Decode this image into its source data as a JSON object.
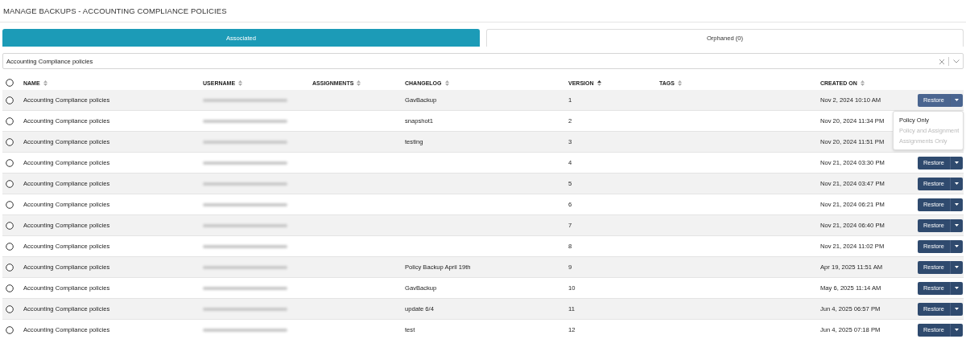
{
  "title": "MANAGE BACKUPS - ACCOUNTING COMPLIANCE POLICIES",
  "tabs": [
    {
      "label": "Associated",
      "selected": true
    },
    {
      "label": "Orphaned (0)",
      "selected": false
    }
  ],
  "filter": {
    "value": "Accounting Compliance policies"
  },
  "table": {
    "select_all": {
      "checked": false
    },
    "columns": [
      {
        "label": "NAME",
        "sorted": false
      },
      {
        "label": "USERNAME",
        "sorted": false
      },
      {
        "label": "ASSIGNMENTS",
        "sorted": false
      },
      {
        "label": "CHANGELOG",
        "sorted": false
      },
      {
        "label": "VERSION",
        "sorted": true
      },
      {
        "label": "TAGS",
        "sorted": false
      },
      {
        "label": "CREATED ON",
        "sorted": false
      }
    ],
    "rows": [
      {
        "checked": false,
        "name": "Accounting Compliance policies",
        "changelog": "GavBackup",
        "version": "1",
        "created": "Nov 2, 2024 10:10 AM",
        "action": "Restore"
      },
      {
        "checked": false,
        "name": "Accounting Compliance policies",
        "changelog": "snapshot1",
        "version": "2",
        "created": "Nov 20, 2024 11:34 PM"
      },
      {
        "checked": false,
        "name": "Accounting Compliance policies",
        "changelog": "testing",
        "version": "3",
        "created": "Nov 20, 2024 11:51 PM"
      },
      {
        "checked": false,
        "name": "Accounting Compliance policies",
        "version": "4",
        "created": "Nov 21, 2024 03:30 PM",
        "action": "Restore"
      },
      {
        "checked": false,
        "name": "Accounting Compliance policies",
        "version": "5",
        "created": "Nov 21, 2024 03:47 PM",
        "action": "Restore"
      },
      {
        "checked": false,
        "name": "Accounting Compliance policies",
        "version": "6",
        "created": "Nov 21, 2024 06:21 PM",
        "action": "Restore"
      },
      {
        "checked": false,
        "name": "Accounting Compliance policies",
        "version": "7",
        "created": "Nov 21, 2024 06:40 PM",
        "action": "Restore"
      },
      {
        "checked": false,
        "name": "Accounting Compliance policies",
        "version": "8",
        "created": "Nov 21, 2024 11:02 PM",
        "action": "Restore"
      },
      {
        "checked": false,
        "name": "Accounting Compliance policies",
        "changelog": "Policy Backup April 19th",
        "version": "9",
        "created": "Apr 19, 2025 11:51 AM",
        "action": "Restore"
      },
      {
        "checked": false,
        "name": "Accounting Compliance policies",
        "changelog": "GavBackup",
        "version": "10",
        "created": "May 6, 2025 11:14 AM",
        "action": "Restore"
      },
      {
        "checked": false,
        "name": "Accounting Compliance policies",
        "changelog": "update 6/4",
        "version": "11",
        "created": "Jun 4, 2025 06:57 PM",
        "action": "Restore"
      },
      {
        "checked": false,
        "name": "Accounting Compliance policies",
        "changelog": "test",
        "version": "12",
        "created": "Jun 4, 2025 07:18 PM",
        "action": "Restore"
      }
    ]
  },
  "restore_menu": {
    "items": [
      {
        "label": "Policy Only",
        "disabled": false
      },
      {
        "label": "Policy and Assignment",
        "disabled": true
      },
      {
        "label": "Assignments Only",
        "disabled": true
      }
    ]
  }
}
